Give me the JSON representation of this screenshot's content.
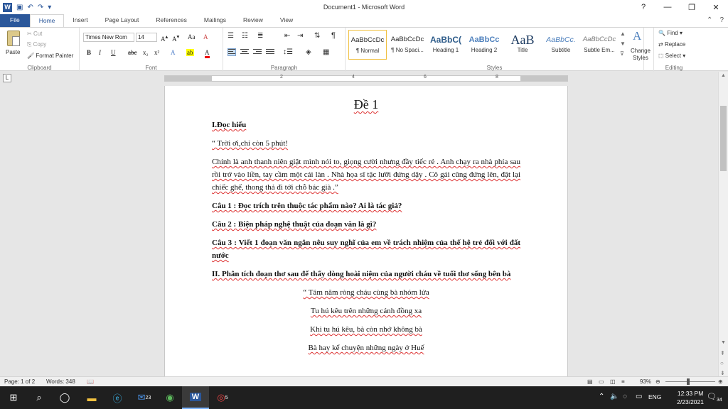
{
  "window": {
    "title": "Document1 - Microsoft Word"
  },
  "qat": {
    "undo": "↶",
    "redo": "↷",
    "customize": "▾"
  },
  "tabs": [
    {
      "label": "File"
    },
    {
      "label": "Home"
    },
    {
      "label": "Insert"
    },
    {
      "label": "Page Layout"
    },
    {
      "label": "References"
    },
    {
      "label": "Mailings"
    },
    {
      "label": "Review"
    },
    {
      "label": "View"
    }
  ],
  "ribbon": {
    "clipboard": {
      "label": "Clipboard",
      "paste": "Paste",
      "cut": "Cut",
      "copy": "Copy",
      "format_painter": "Format Painter"
    },
    "font": {
      "label": "Font",
      "name": "Times New Rom",
      "size": "14"
    },
    "paragraph": {
      "label": "Paragraph"
    },
    "styles": {
      "label": "Styles",
      "items": [
        {
          "preview": "AaBbCcDc",
          "name": "¶ Normal"
        },
        {
          "preview": "AaBbCcDc",
          "name": "¶ No Spaci..."
        },
        {
          "preview": "AaBbC(",
          "name": "Heading 1"
        },
        {
          "preview": "AaBbCc",
          "name": "Heading 2"
        },
        {
          "preview": "AaB",
          "name": "Title"
        },
        {
          "preview": "AaBbCc.",
          "name": "Subtitle"
        },
        {
          "preview": "AaBbCcDc",
          "name": "Subtle Em..."
        }
      ],
      "change_styles": "Change Styles"
    },
    "editing": {
      "label": "Editing",
      "find": "Find",
      "replace": "Replace",
      "select": "Select"
    }
  },
  "document": {
    "title": "Đề 1",
    "paragraphs": [
      {
        "text": "I.Đọc hiểu"
      },
      {
        "text": "“ Trời ơi,chỉ còn 5 phút!"
      },
      {
        "text": "Chính là anh thanh niên giật mình nói to, giọng cười nhưng đầy tiếc rẻ . Anh chạy ra nhà phía sau rồi trở vào liền, tay cầm một cái làn . Nhà họa sĩ tặc lưỡi đứng dậy . Cô gái cũng đứng lên, đặt lại chiếc ghế, thong thả đi tới chỗ bác già .”"
      },
      {
        "text": "Câu 1 : Đọc trích trên thuộc tác phẩm nào? Ai là tác giả?"
      },
      {
        "text": "Câu 2 : Biện pháp nghệ thuật của đoạn văn là gì?"
      },
      {
        "text": "Câu 3 : Viết 1 đoạn văn ngắn nêu suy nghĩ của em về trách nhiệm của thế hệ trẻ đối với đất nước"
      },
      {
        "text": "II. Phân tích đoạn thơ sau để thấy dòng hoài niệm của người cháu về tuổi thơ sống bên bà"
      },
      {
        "text": "“ Tám năm ròng cháu cùng bà nhóm lửa"
      },
      {
        "text": "Tu hú kêu trên những cánh đồng xa"
      },
      {
        "text": "Khi tu hú kêu, bà còn nhớ không bà"
      },
      {
        "text": "Bà hay kể chuyện những ngày ở Huế"
      }
    ]
  },
  "status": {
    "page": "Page: 1 of 2",
    "words": "Words: 348",
    "zoom": "93%"
  },
  "taskbar": {
    "time": "12:33 PM",
    "date": "2/23/2021",
    "lang": "ENG",
    "mail_badge": "23",
    "chrome_badge": "5",
    "notif_badge": "34"
  }
}
